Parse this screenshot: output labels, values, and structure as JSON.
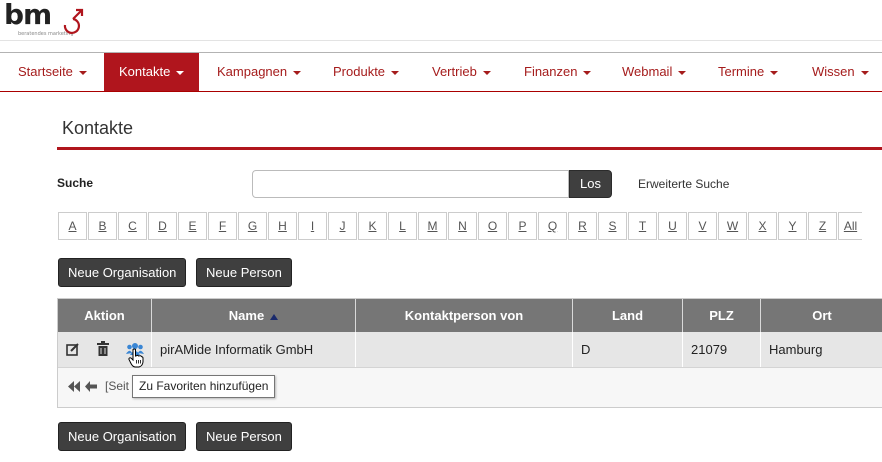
{
  "brand": {
    "logo_text": "bm",
    "logo_sub": "beratendes marketing"
  },
  "nav": {
    "items": [
      {
        "label": "Startseite"
      },
      {
        "label": "Kontakte"
      },
      {
        "label": "Kampagnen"
      },
      {
        "label": "Produkte"
      },
      {
        "label": "Vertrieb"
      },
      {
        "label": "Finanzen"
      },
      {
        "label": "Webmail"
      },
      {
        "label": "Termine"
      },
      {
        "label": "Wissen"
      }
    ],
    "active": "Kontakte",
    "accent_color": "#b0151d"
  },
  "page": {
    "title": "Kontakte"
  },
  "search": {
    "label": "Suche",
    "value": "",
    "button": "Los",
    "advanced": "Erweiterte Suche"
  },
  "alphabet": [
    "A",
    "B",
    "C",
    "D",
    "E",
    "F",
    "G",
    "H",
    "I",
    "J",
    "K",
    "L",
    "M",
    "N",
    "O",
    "P",
    "Q",
    "R",
    "S",
    "T",
    "U",
    "V",
    "W",
    "X",
    "Y",
    "Z",
    "All"
  ],
  "actions": {
    "new_org": "Neue Organisation",
    "new_person": "Neue Person"
  },
  "table": {
    "headers": {
      "action": "Aktion",
      "name": "Name",
      "contact_of": "Kontaktperson von",
      "country": "Land",
      "zip": "PLZ",
      "city": "Ort"
    },
    "sort": {
      "column": "Name",
      "direction": "ascending"
    },
    "rows": [
      {
        "name": "pirAMide Informatik GmbH",
        "contact_of": "",
        "country": "D",
        "zip": "21079",
        "city": "Hamburg"
      }
    ],
    "pager_text": "[Seit"
  },
  "tooltip": "Zu Favoriten hinzufügen"
}
